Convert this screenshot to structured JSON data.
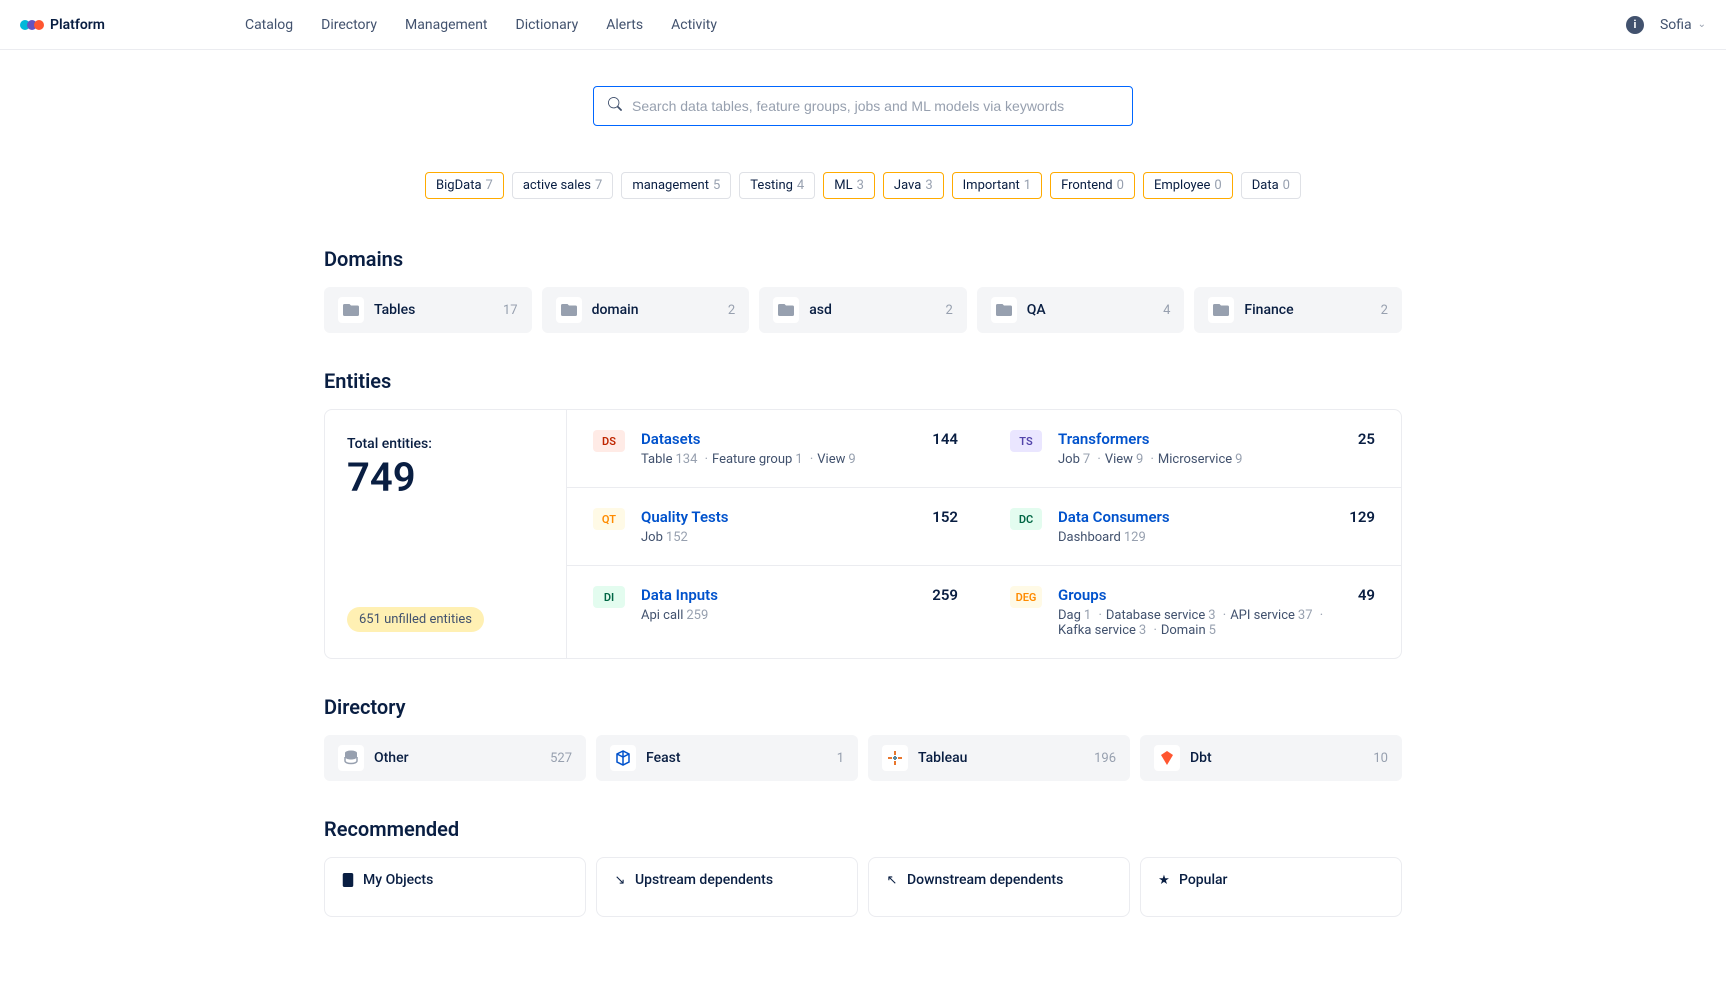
{
  "header": {
    "logo_text": "Platform",
    "nav": [
      "Catalog",
      "Directory",
      "Management",
      "Dictionary",
      "Alerts",
      "Activity"
    ],
    "user": "Sofia"
  },
  "search": {
    "placeholder": "Search data tables, feature groups, jobs and ML models via keywords"
  },
  "tags": [
    {
      "label": "BigData",
      "count": "7",
      "important": true
    },
    {
      "label": "active sales",
      "count": "7",
      "important": false
    },
    {
      "label": "management",
      "count": "5",
      "important": false
    },
    {
      "label": "Testing",
      "count": "4",
      "important": false
    },
    {
      "label": "ML",
      "count": "3",
      "important": true
    },
    {
      "label": "Java",
      "count": "3",
      "important": true
    },
    {
      "label": "Important",
      "count": "1",
      "important": true
    },
    {
      "label": "Frontend",
      "count": "0",
      "important": true
    },
    {
      "label": "Employee",
      "count": "0",
      "important": true
    },
    {
      "label": "Data",
      "count": "0",
      "important": false
    }
  ],
  "domains_title": "Domains",
  "domains": [
    {
      "name": "Tables",
      "count": "17"
    },
    {
      "name": "domain",
      "count": "2"
    },
    {
      "name": "asd",
      "count": "2"
    },
    {
      "name": "QA",
      "count": "4"
    },
    {
      "name": "Finance",
      "count": "2"
    }
  ],
  "entities_title": "Entities",
  "entities": {
    "total_label": "Total entities:",
    "total": "749",
    "unfilled": "651 unfilled entities",
    "items": [
      {
        "badge": "DS",
        "badge_class": "badge-ds",
        "name": "Datasets",
        "total": "144",
        "subs": [
          {
            "label": "Table",
            "count": "134"
          },
          {
            "label": "Feature group",
            "count": "1"
          },
          {
            "label": "View",
            "count": "9"
          }
        ]
      },
      {
        "badge": "TS",
        "badge_class": "badge-ts",
        "name": "Transformers",
        "total": "25",
        "subs": [
          {
            "label": "Job",
            "count": "7"
          },
          {
            "label": "View",
            "count": "9"
          },
          {
            "label": "Microservice",
            "count": "9"
          }
        ]
      },
      {
        "badge": "QT",
        "badge_class": "badge-qt",
        "name": "Quality Tests",
        "total": "152",
        "subs": [
          {
            "label": "Job",
            "count": "152"
          }
        ]
      },
      {
        "badge": "DC",
        "badge_class": "badge-dc",
        "name": "Data Consumers",
        "total": "129",
        "subs": [
          {
            "label": "Dashboard",
            "count": "129"
          }
        ]
      },
      {
        "badge": "DI",
        "badge_class": "badge-di",
        "name": "Data Inputs",
        "total": "259",
        "subs": [
          {
            "label": "Api call",
            "count": "259"
          }
        ]
      },
      {
        "badge": "DEG",
        "badge_class": "badge-deg",
        "name": "Groups",
        "total": "49",
        "subs": [
          {
            "label": "Dag",
            "count": "1"
          },
          {
            "label": "Database service",
            "count": "3"
          },
          {
            "label": "API service",
            "count": "37"
          },
          {
            "label": "Kafka service",
            "count": "3"
          },
          {
            "label": "Domain",
            "count": "5"
          }
        ]
      }
    ]
  },
  "directory_title": "Directory",
  "directory": [
    {
      "name": "Other",
      "count": "527",
      "icon": "db",
      "color": "#97A0AF"
    },
    {
      "name": "Feast",
      "count": "1",
      "icon": "feast",
      "color": "#0052CC"
    },
    {
      "name": "Tableau",
      "count": "196",
      "icon": "tableau",
      "color": "#E8762D"
    },
    {
      "name": "Dbt",
      "count": "10",
      "icon": "dbt",
      "color": "#FF5630"
    }
  ],
  "recommended_title": "Recommended",
  "recommended": [
    {
      "title": "My Objects",
      "icon": "book"
    },
    {
      "title": "Upstream dependents",
      "icon": "arrow-down-right"
    },
    {
      "title": "Downstream dependents",
      "icon": "arrow-up-left"
    },
    {
      "title": "Popular",
      "icon": "star"
    }
  ]
}
